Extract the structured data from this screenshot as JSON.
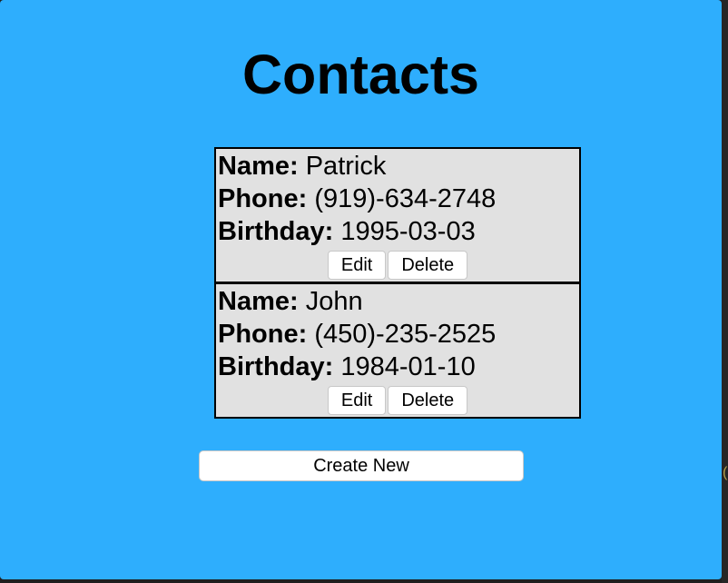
{
  "page": {
    "title": "Contacts",
    "background_color": "#2eaefd",
    "card_color": "#e1e1e1"
  },
  "contacts": [
    {
      "name_label": "Name:",
      "name": "Patrick",
      "phone_label": "Phone:",
      "phone": "(919)-634-2748",
      "birthday_label": "Birthday:",
      "birthday": "1995-03-03",
      "edit_label": "Edit",
      "delete_label": "Delete"
    },
    {
      "name_label": "Name:",
      "name": "John",
      "phone_label": "Phone:",
      "phone": "(450)-235-2525",
      "birthday_label": "Birthday:",
      "birthday": "1984-01-10",
      "edit_label": "Edit",
      "delete_label": "Delete"
    }
  ],
  "actions": {
    "create_new_label": "Create New"
  },
  "edge": {
    "partial_glyph": "("
  }
}
